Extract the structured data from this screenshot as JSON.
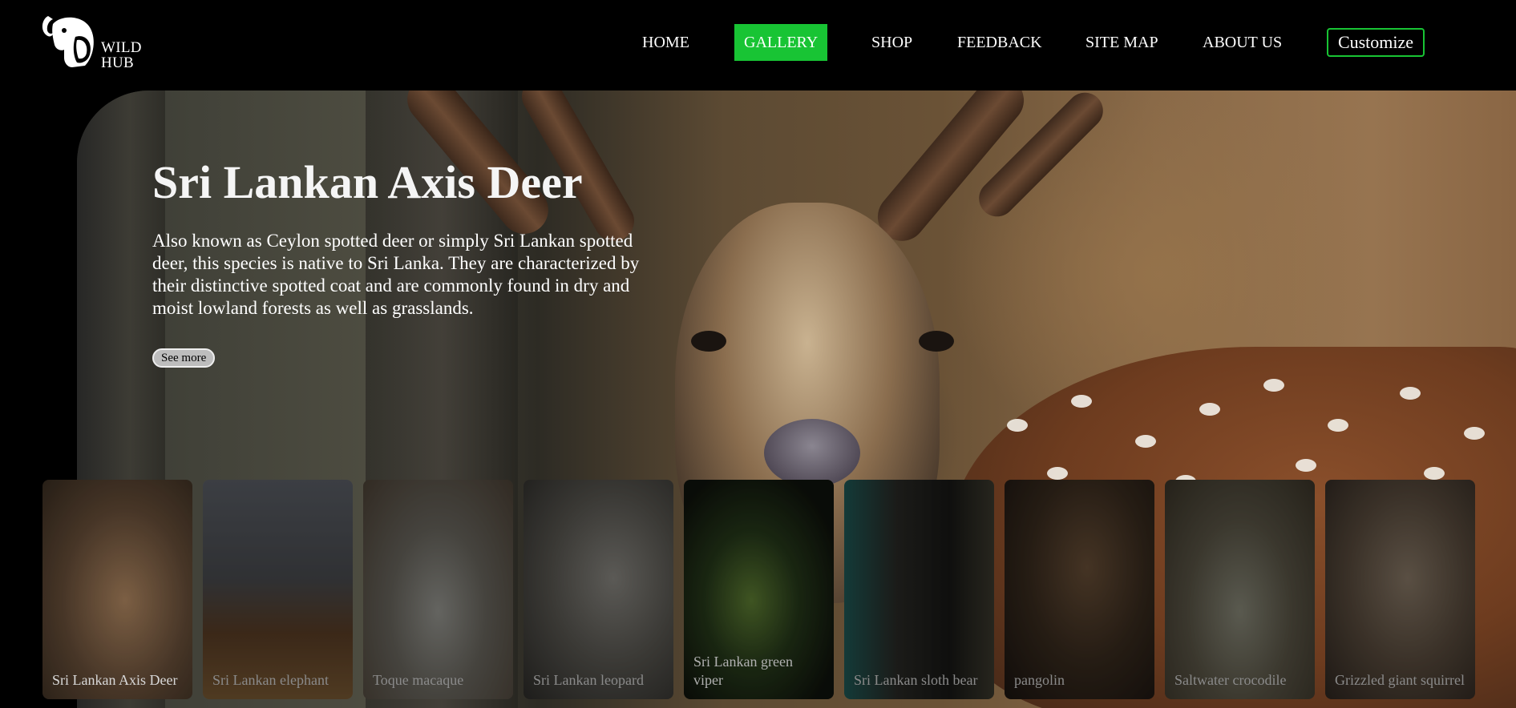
{
  "logo": {
    "line1": "WILD",
    "line2": "HUB",
    "icon": "elephant-icon"
  },
  "nav": {
    "items": [
      {
        "label": "HOME"
      },
      {
        "label": "GALLERY",
        "active": true
      },
      {
        "label": "SHOP"
      },
      {
        "label": "FEEDBACK"
      },
      {
        "label": "SITE MAP"
      },
      {
        "label": "ABOUT US"
      }
    ],
    "customize_label": "Customize",
    "accent_color": "#18c434"
  },
  "hero": {
    "title": "Sri Lankan Axis Deer",
    "description": "Also known as Ceylon spotted deer or simply Sri Lankan spotted deer, this species is native to Sri Lanka. They are characterized by their distinctive spotted coat and are commonly found in dry and moist lowland forests as well as grasslands.",
    "see_more_label": "See more"
  },
  "cards": [
    {
      "label": "Sri Lankan Axis Deer",
      "label_color": "#d8d8d8"
    },
    {
      "label": "Sri Lankan elephant",
      "label_color": "#8a8a8a"
    },
    {
      "label": "Toque macaque",
      "label_color": "#8a8a8a"
    },
    {
      "label": "Sri Lankan leopard",
      "label_color": "#8a8a8a"
    },
    {
      "label": "Sri Lankan green viper",
      "label_color": "#b0b0b0"
    },
    {
      "label": "Sri Lankan sloth bear",
      "label_color": "#8a8a8a"
    },
    {
      "label": "pangolin",
      "label_color": "#8a8a8a"
    },
    {
      "label": "Saltwater crocodile",
      "label_color": "#8a8a8a"
    },
    {
      "label": "Grizzled giant squirrel",
      "label_color": "#8a8a8a"
    }
  ]
}
